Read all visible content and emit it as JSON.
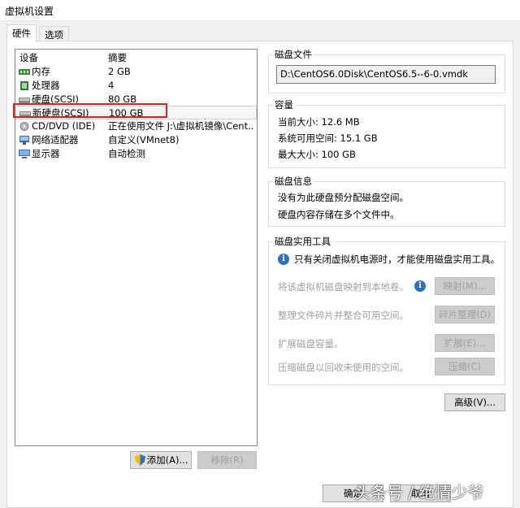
{
  "window": {
    "title": "虚拟机设置"
  },
  "tabs": [
    {
      "label": "硬件",
      "active": true
    },
    {
      "label": "选项",
      "active": false
    }
  ],
  "device_list": {
    "headers": {
      "device": "设备",
      "summary": "摘要"
    },
    "rows": [
      {
        "device": "内存",
        "summary": "2 GB",
        "icon": "memory-icon"
      },
      {
        "device": "处理器",
        "summary": "4",
        "icon": "processor-icon"
      },
      {
        "device": "硬盘(SCSI)",
        "summary": "80 GB",
        "icon": "harddisk-icon"
      },
      {
        "device": "新硬盘(SCSI)",
        "summary": "100 GB",
        "icon": "harddisk-icon",
        "selected": true
      },
      {
        "device": "CD/DVD (IDE)",
        "summary": "正在使用文件 J:\\虚拟机镜像\\Cent...",
        "icon": "cdrom-icon"
      },
      {
        "device": "网络适配器",
        "summary": "自定义(VMnet8)",
        "icon": "network-icon"
      },
      {
        "device": "显示器",
        "summary": "自动检测",
        "icon": "display-icon"
      }
    ],
    "add_button": "添加(A)...",
    "remove_button": "移除(R)"
  },
  "disk_file": {
    "label": "磁盘文件",
    "path": "D:\\CentOS6.0Disk\\CentOS6.5--6-0.vmdk"
  },
  "capacity": {
    "label": "容量",
    "current_size": "当前大小: 12.6 MB",
    "system_free": "系统可用空间: 15.1 GB",
    "max_size": "最大大小: 100 GB"
  },
  "disk_info": {
    "label": "磁盘信息",
    "line1": "没有为此硬盘预分配磁盘空间。",
    "line2": "硬盘内容存储在多个文件中。"
  },
  "disk_utilities": {
    "label": "磁盘实用工具",
    "notice": "只有关闭虚拟机电源时，才能使用磁盘实用工具。",
    "map_desc": "将该虚拟机磁盘映射到本地卷。",
    "map_button": "映射(M)...",
    "defrag_desc": "整理文件碎片并整合可用空间。",
    "defrag_button": "碎片整理(D)",
    "expand_desc": "扩展磁盘容量。",
    "expand_button": "扩展(E)...",
    "compact_desc": "压缩磁盘以回收未使用的空间。",
    "compact_button": "压缩(C)"
  },
  "advanced_button": "高级(V)...",
  "footer": {
    "ok_button": "确定",
    "cancel_button": "取消"
  },
  "watermark": "头条号 / 绝情少爷",
  "colors": {
    "highlight_box": "#e02020",
    "list_border": "#828790",
    "disabled_text": "#a0a0a0"
  }
}
